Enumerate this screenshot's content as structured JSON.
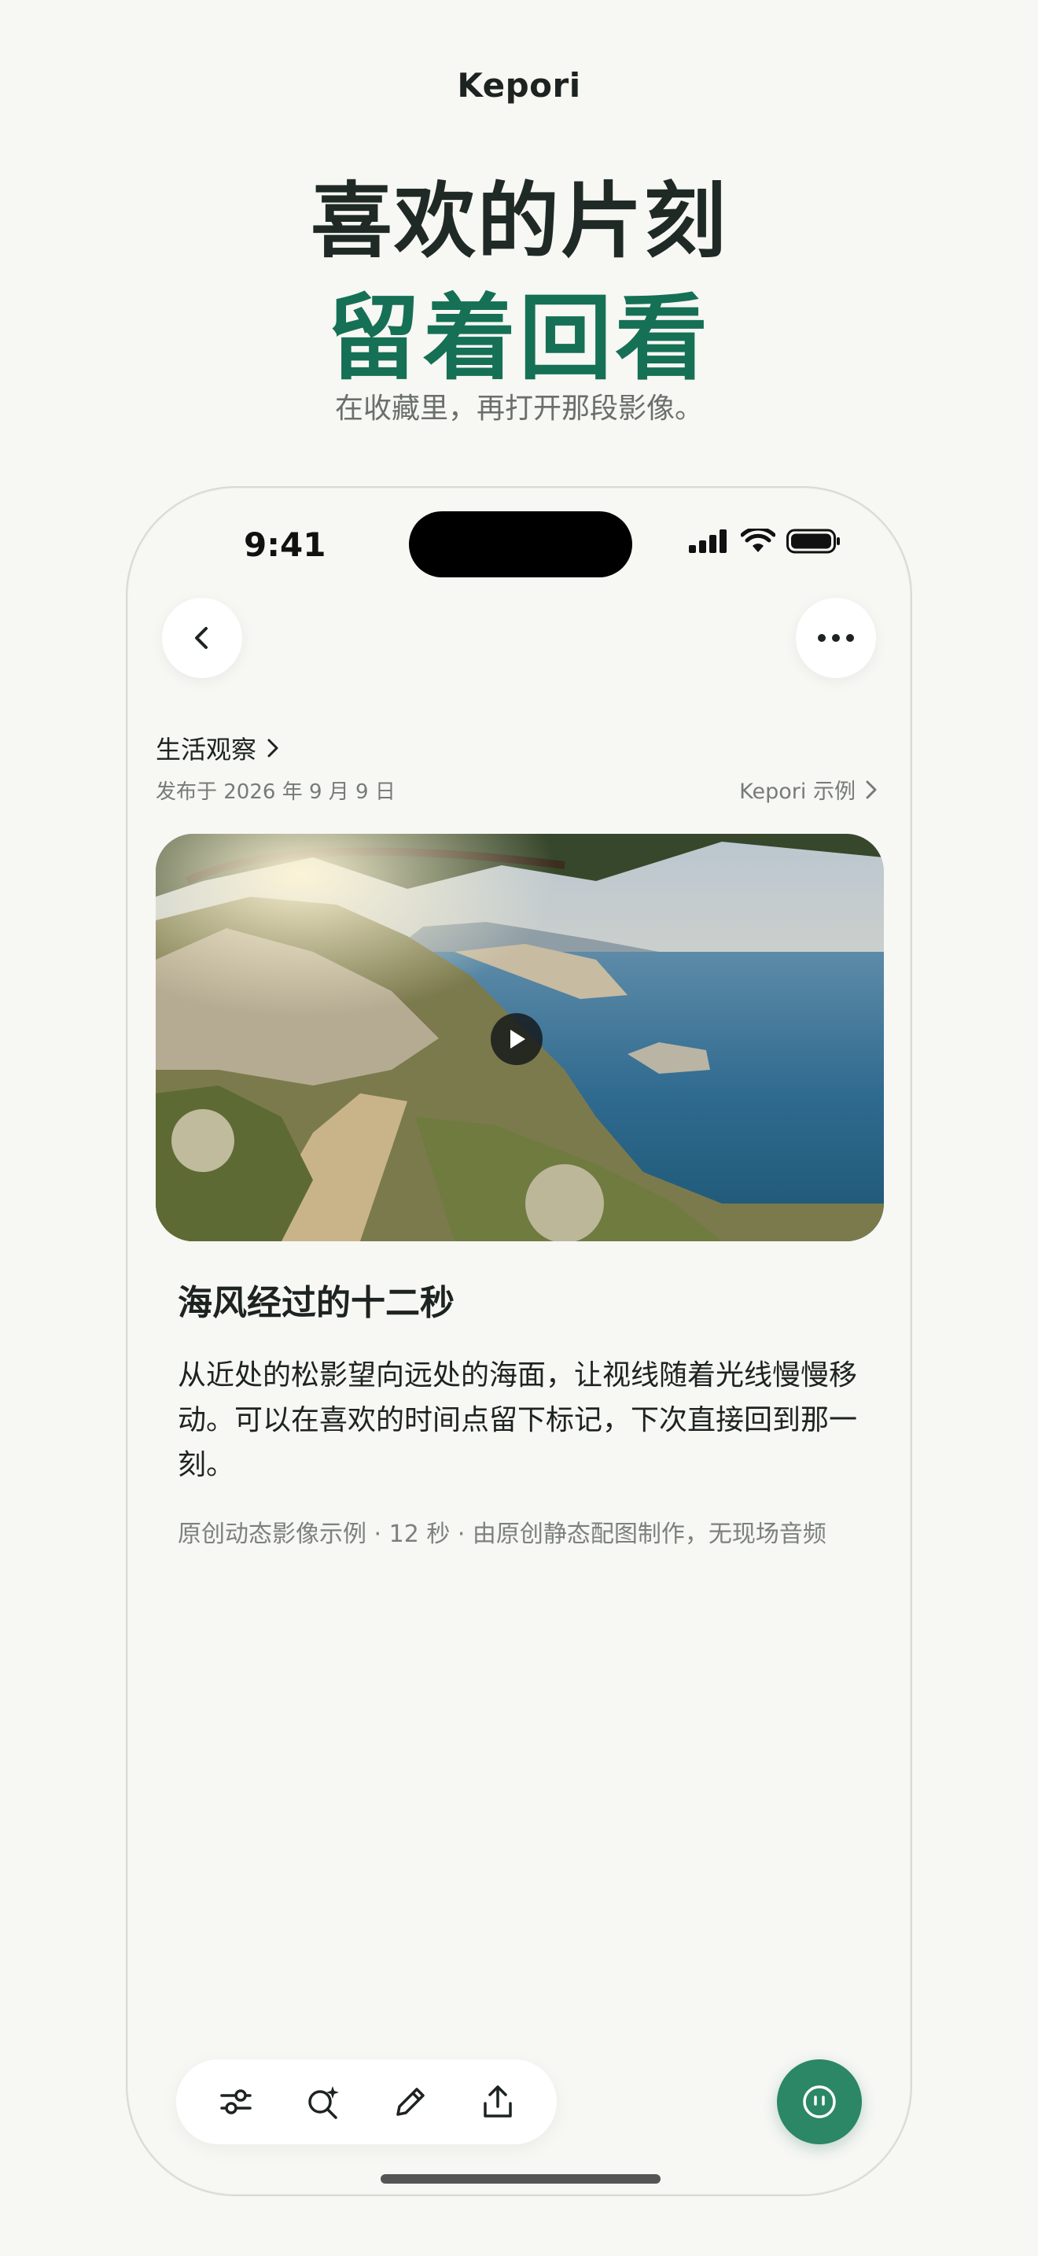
{
  "app": {
    "name": "Kepori"
  },
  "hero": {
    "line1": "喜欢的片刻",
    "line2": "留着回看",
    "subtitle": "在收藏里，再打开那段影像。"
  },
  "status_bar": {
    "time": "9:41"
  },
  "article": {
    "category": "生活观察",
    "published": "发布于 2026 年 9 月 9 日",
    "source": "Kepori 示例",
    "title": "海风经过的十二秒",
    "body": "从近处的松影望向远处的海面，让视线随着光线慢慢移动。可以在喜欢的时间点留下标记，下次直接回到那一刻。",
    "caption": "原创动态影像示例 · 12 秒 · 由原创静态配图制作，无现场音频"
  },
  "icons": {
    "back": "chevron-left-icon",
    "more": "more-horizontal-icon",
    "play": "play-icon",
    "toolbar": [
      "sliders-icon",
      "ai-search-icon",
      "edit-pencil-icon",
      "share-upload-icon"
    ],
    "fab": "assistant-icon"
  },
  "colors": {
    "accent": "#157055",
    "fab": "#2b8766",
    "background": "#f7f7f3"
  }
}
